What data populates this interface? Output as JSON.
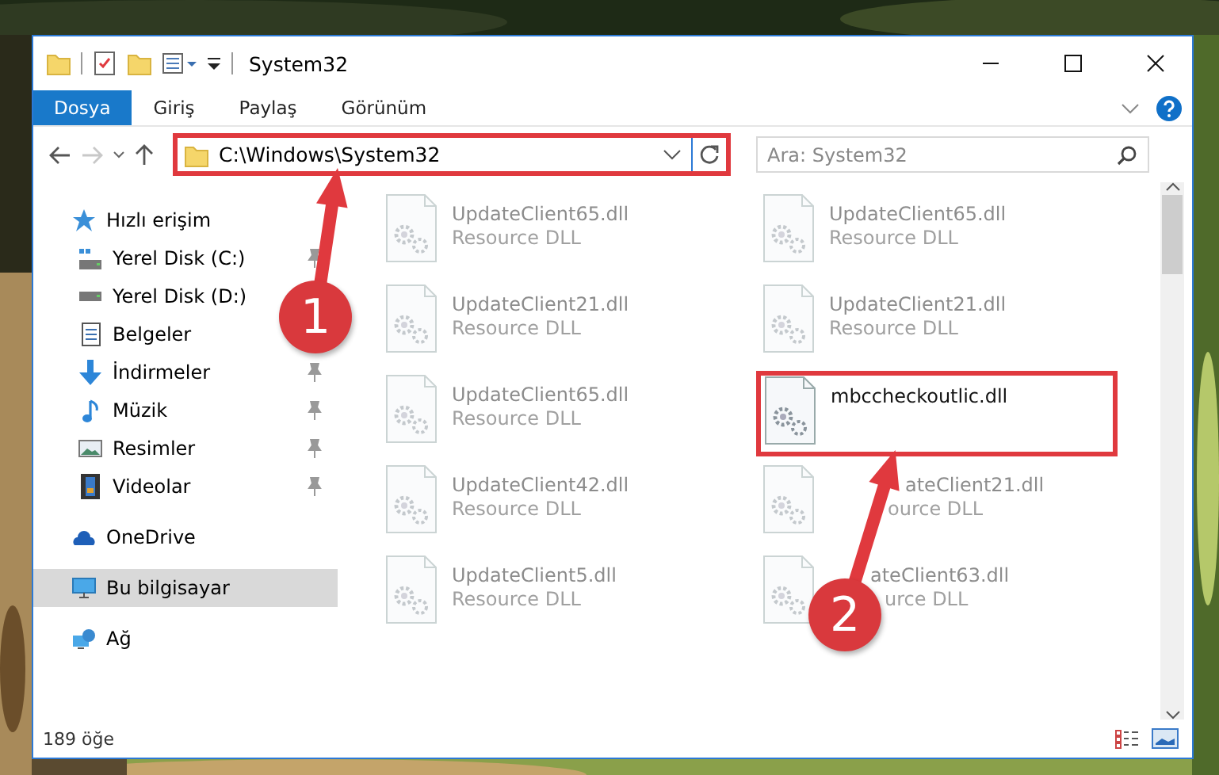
{
  "window": {
    "title": "System32"
  },
  "ribbon_tabs": [
    {
      "label": "Dosya",
      "selected": true
    },
    {
      "label": "Giriş",
      "selected": false
    },
    {
      "label": "Paylaş",
      "selected": false
    },
    {
      "label": "Görünüm",
      "selected": false
    }
  ],
  "address": {
    "path": "C:\\Windows\\System32",
    "highlighted": true
  },
  "search": {
    "placeholder": "Ara: System32"
  },
  "sidebar": {
    "items": [
      {
        "label": "Hızlı erişim",
        "kind": "star",
        "selected": false,
        "children": [
          {
            "label": "Yerel Disk (C:)",
            "kind": "drive-c",
            "selected": false,
            "pinned": true
          },
          {
            "label": "Yerel Disk (D:)",
            "kind": "drive",
            "selected": false
          },
          {
            "label": "Belgeler",
            "kind": "document",
            "selected": false
          },
          {
            "label": "İndirmeler",
            "kind": "download",
            "selected": false,
            "pinned": true
          },
          {
            "label": "Müzik",
            "kind": "music",
            "selected": false,
            "pinned": true
          },
          {
            "label": "Resimler",
            "selected": false,
            "pinned": true
          },
          {
            "label": "Videolar",
            "kind": "video",
            "selected": false,
            "pinned": true
          }
        ]
      },
      {
        "label": "OneDrive",
        "kind": "cloud",
        "selected": false
      },
      {
        "label": "Bu bilgisayar",
        "kind": "pc",
        "selected": true
      },
      {
        "label": "Ağ",
        "kind": "network",
        "selected": false
      }
    ]
  },
  "files": [
    {
      "name": "UpdateClient65.dll",
      "type": "Resource DLL",
      "blurred": true,
      "highlighted": false
    },
    {
      "name": "UpdateClient65.dll",
      "type": "Resource DLL",
      "blurred": true,
      "highlighted": false
    },
    {
      "name": "UpdateClient21.dll",
      "type": "Resource DLL",
      "blurred": true,
      "highlighted": false
    },
    {
      "name": "UpdateClient21.dll",
      "type": "Resource DLL",
      "blurred": true,
      "highlighted": false
    },
    {
      "name": "UpdateClient65.dll",
      "type": "Resource DLL",
      "blurred": true,
      "highlighted": false
    },
    {
      "name": "mbccheckoutlic.dll",
      "blurred": false,
      "highlighted": true
    },
    {
      "name": "UpdateClient42.dll",
      "type": "Resource DLL",
      "blurred": true,
      "highlighted": false
    },
    {
      "name": "ateClient21.dll",
      "type": "ource DLL",
      "blurred": true,
      "highlighted": false,
      "covered": true
    },
    {
      "name": "UpdateClient5.dll",
      "type": "Resource DLL",
      "blurred": true,
      "highlighted": false
    },
    {
      "name": "ateClient63.dll",
      "type": "urce DLL",
      "blurred": true,
      "highlighted": false,
      "covered": true
    }
  ],
  "status_bar": {
    "count": "189 öğe"
  },
  "callouts": [
    {
      "number": "1"
    },
    {
      "number": "2"
    }
  ]
}
